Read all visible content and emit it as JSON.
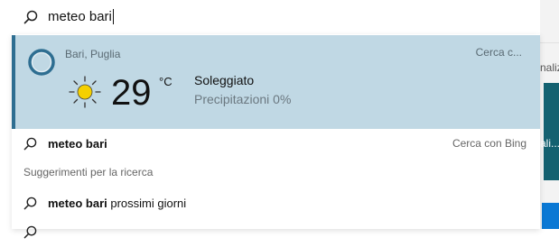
{
  "search": {
    "query": "meteo bari"
  },
  "weather": {
    "location": "Bari, Puglia",
    "action_label": "Cerca c...",
    "temperature": "29",
    "unit": "°C",
    "condition": "Soleggiato",
    "precipitation": "Precipitazioni 0%",
    "icon": "sun-icon"
  },
  "suggestions_top": {
    "query_text": "meteo bari",
    "action_label": "Cerca con Bing"
  },
  "section_heading": "Suggerimenti per la ricerca",
  "suggestions": [
    {
      "bold": "meteo bari",
      "rest": " prossimi giorni"
    }
  ],
  "background_app": {
    "text_top": "nalizi",
    "text_mid": "ali..."
  },
  "colors": {
    "card_bg": "#c0d8e4",
    "card_accent": "#2e6e91",
    "sun": "#f5d000",
    "teal": "#146170",
    "blue": "#0a78d4"
  }
}
